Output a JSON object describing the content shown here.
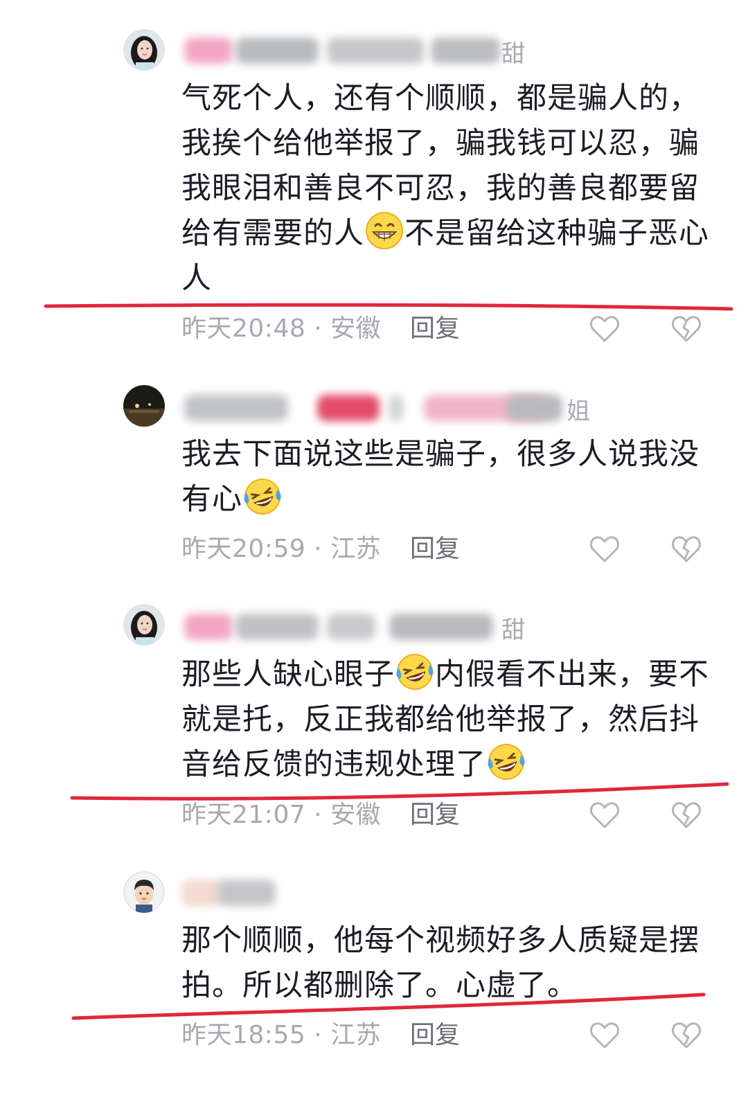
{
  "comments": [
    {
      "name_tail": "甜",
      "text_parts": [
        "气死个人，还有个顺顺，都是骗人的，我挨个给他举报了，骗我钱可以忍，骗我眼泪和善良不可忍，我的善良都要留给有需要的人",
        "不是留给这种骗子恶心人"
      ],
      "emoji": "grin-emoji",
      "time_location": "昨天20:48 · 安徽",
      "reply_label": "回复"
    },
    {
      "name_tail": "姐",
      "text_parts": [
        "我去下面说这些是骗子，很多人说我没有心"
      ],
      "emoji": "laugh-cry-emoji",
      "time_location": "昨天20:59 · 江苏",
      "reply_label": "回复"
    },
    {
      "name_tail": "甜",
      "text_parts": [
        "那些人缺心眼子",
        "内假看不出来，要不就是托，反正我都给他举报了，然后抖音给反馈的违规处理了"
      ],
      "emoji": "laugh-cry-emoji",
      "time_location": "昨天21:07 · 安徽",
      "reply_label": "回复"
    },
    {
      "name_tail": "",
      "text_parts": [
        "那个顺顺，他每个视频好多人质疑是摆拍。所以都删除了。心虚了。"
      ],
      "emoji": "",
      "time_location": "昨天18:55 · 江苏",
      "reply_label": "回复"
    }
  ],
  "colors": {
    "annotation_underline": "#e0283a",
    "meta_text": "#a8a9af",
    "body_text": "#1c1d24"
  },
  "icons": {
    "like": "heart-outline-icon",
    "dislike": "broken-heart-icon"
  }
}
